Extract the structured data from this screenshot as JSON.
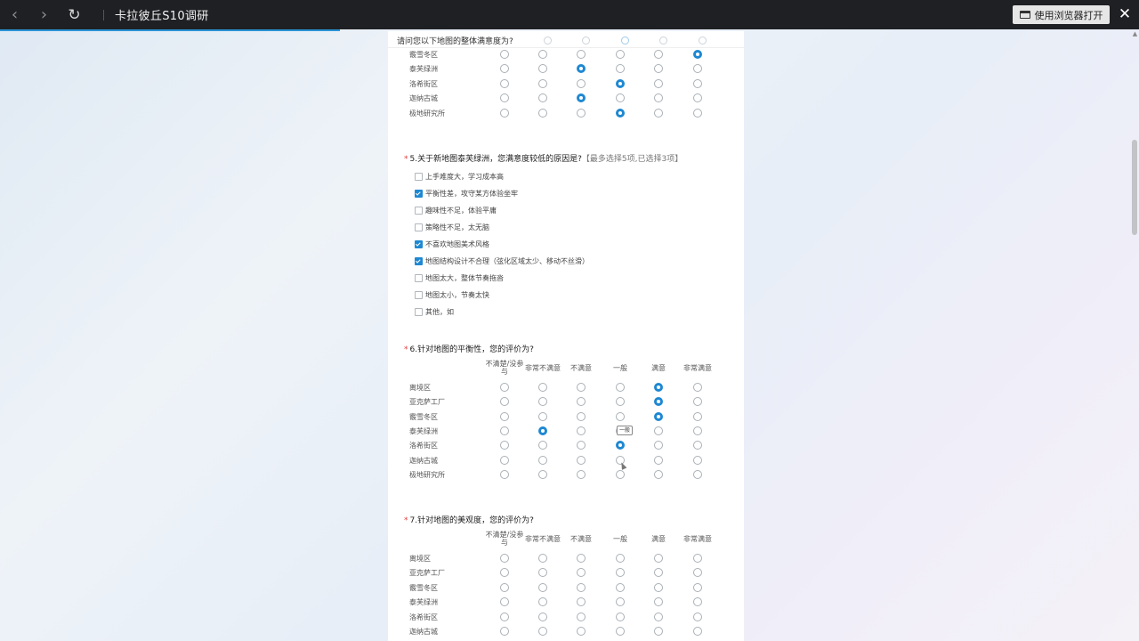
{
  "titlebar": {
    "back_icon": "chevron-left-icon",
    "forward_icon": "chevron-right-icon",
    "refresh_icon": "refresh-icon",
    "title": "卡拉彼丘S10调研",
    "open_browser_label": "使用浏览器打开",
    "close_icon": "close-icon"
  },
  "colors": {
    "accent": "#1e88d2",
    "titlebar": "#1f2024"
  },
  "sticky_question": "请问您以下地图的整体满意度为?",
  "q4_partial": {
    "rows": [
      {
        "label": "霰雪冬区",
        "selected": 5
      },
      {
        "label": "泰芙绿洲",
        "selected": 2
      },
      {
        "label": "洛希街区",
        "selected": 3
      },
      {
        "label": "迦纳古城",
        "selected": 2
      },
      {
        "label": "极地研究所",
        "selected": 3
      }
    ]
  },
  "q5": {
    "number": "5.",
    "title": "关于新地图泰芙绿洲，您满意度较低的原因是?",
    "hint": "【最多选择5项,已选择3项】",
    "options": [
      {
        "label": "上手难度大，学习成本高",
        "checked": false
      },
      {
        "label": "平衡性差，攻守某方体验坐牢",
        "checked": true
      },
      {
        "label": "趣味性不足，体验平庸",
        "checked": false
      },
      {
        "label": "策略性不足，太无脑",
        "checked": false
      },
      {
        "label": "不喜欢地图美术风格",
        "checked": true
      },
      {
        "label": "地图结构设计不合理（弦化区域太少、移动不丝滑）",
        "checked": true
      },
      {
        "label": "地图太大，整体节奏拖沓",
        "checked": false
      },
      {
        "label": "地图太小，节奏太快",
        "checked": false
      },
      {
        "label": "其他，如",
        "checked": false
      }
    ]
  },
  "scale_columns": [
    "不清楚/没参与",
    "非常不满意",
    "不满意",
    "一般",
    "满意",
    "非常满意"
  ],
  "q6": {
    "number": "6.",
    "title": "针对地图的平衡性，您的评价为?",
    "rows": [
      {
        "label": "离境区",
        "selected": 4
      },
      {
        "label": "亚克萨工厂",
        "selected": 4
      },
      {
        "label": "霰雪冬区",
        "selected": 4
      },
      {
        "label": "泰芙绿洲",
        "selected": 1
      },
      {
        "label": "洛希街区",
        "selected": 3
      },
      {
        "label": "迦纳古城",
        "selected": -1
      },
      {
        "label": "极地研究所",
        "selected": -1
      }
    ],
    "tooltip": "一般"
  },
  "q7": {
    "number": "7.",
    "title": "针对地图的美观度，您的评价为?",
    "rows": [
      {
        "label": "离境区",
        "selected": -1
      },
      {
        "label": "亚克萨工厂",
        "selected": -1
      },
      {
        "label": "霰雪冬区",
        "selected": -1
      },
      {
        "label": "泰芙绿洲",
        "selected": -1
      },
      {
        "label": "洛希街区",
        "selected": -1
      },
      {
        "label": "迦纳古城",
        "selected": -1
      }
    ]
  }
}
